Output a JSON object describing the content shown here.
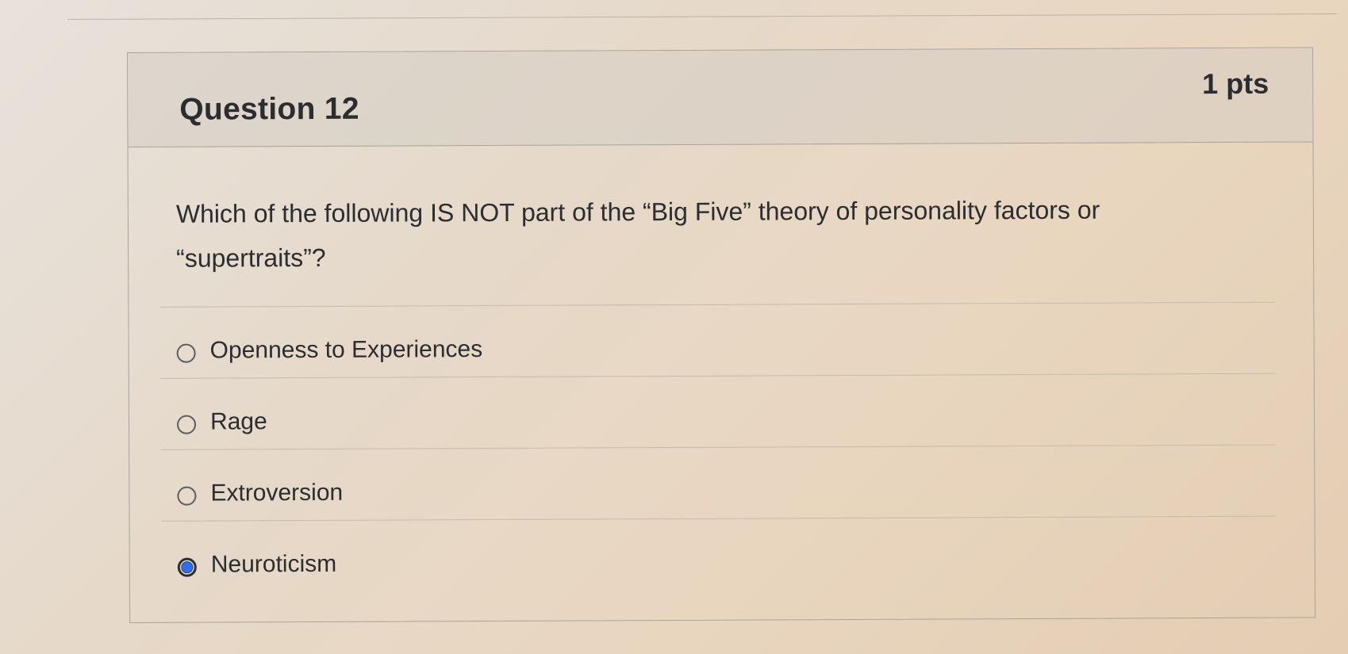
{
  "question": {
    "title": "Question 12",
    "points": "1 pts",
    "text": "Which of the following IS NOT part of the “Big Five” theory of personality factors or “supertraits”?"
  },
  "answers": [
    {
      "label": "Openness to Experiences",
      "selected": false
    },
    {
      "label": "Rage",
      "selected": false
    },
    {
      "label": "Extroversion",
      "selected": false
    },
    {
      "label": "Neuroticism",
      "selected": true
    }
  ],
  "colors": {
    "radio_selected": "#2d6ef0",
    "text": "#2b2d30",
    "border": "#a8a39c"
  }
}
